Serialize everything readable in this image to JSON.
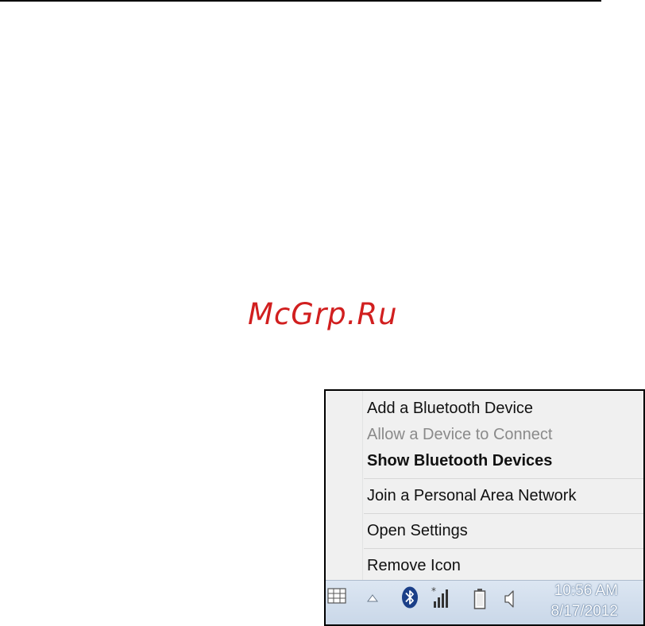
{
  "watermark": "McGrp.Ru",
  "menu": {
    "items": [
      {
        "label": "Add a Bluetooth Device"
      },
      {
        "label": "Allow a Device to Connect"
      },
      {
        "label": "Show Bluetooth Devices"
      },
      {
        "label": "Join a Personal Area Network"
      },
      {
        "label": "Open Settings"
      },
      {
        "label": "Remove Icon"
      }
    ]
  },
  "taskbar": {
    "icons": [
      "keyboard-icon",
      "show-hidden-icons-icon",
      "bluetooth-icon",
      "network-signal-icon",
      "battery-icon",
      "volume-icon"
    ],
    "clock": {
      "time": "10:56 AM",
      "date": "8/17/2012"
    }
  }
}
